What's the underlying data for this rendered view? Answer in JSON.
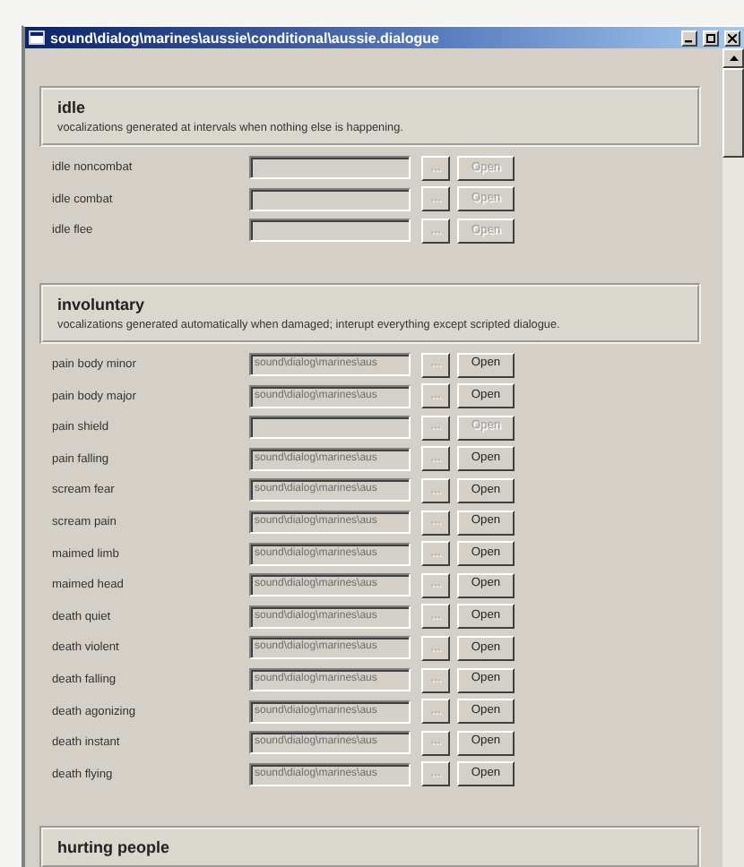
{
  "window": {
    "title": "sound\\dialog\\marines\\aussie\\conditional\\aussie.dialogue"
  },
  "sections": [
    {
      "title": "idle",
      "description": "vocalizations generated at intervals when nothing else is happening.",
      "rows": [
        {
          "label": "idle noncombat",
          "value": "",
          "browse": "...",
          "open": "Open",
          "disabled": true
        },
        {
          "label": "idle combat",
          "value": "",
          "browse": "...",
          "open": "Open",
          "disabled": true
        },
        {
          "label": "idle flee",
          "value": "",
          "browse": "...",
          "open": "Open",
          "disabled": true
        }
      ]
    },
    {
      "title": "involuntary",
      "description": "vocalizations generated automatically when damaged; interupt everything except scripted dialogue.",
      "rows": [
        {
          "label": "pain body minor",
          "value": "sound\\dialog\\marines\\aus",
          "browse": "...",
          "open": "Open",
          "disabled": false
        },
        {
          "label": "pain body major",
          "value": "sound\\dialog\\marines\\aus",
          "browse": "...",
          "open": "Open",
          "disabled": false
        },
        {
          "label": "pain shield",
          "value": "",
          "browse": "...",
          "open": "Open",
          "disabled": true
        },
        {
          "label": "pain falling",
          "value": "sound\\dialog\\marines\\aus",
          "browse": "...",
          "open": "Open",
          "disabled": false
        },
        {
          "label": "scream fear",
          "value": "sound\\dialog\\marines\\aus",
          "browse": "...",
          "open": "Open",
          "disabled": false
        },
        {
          "label": "scream pain",
          "value": "sound\\dialog\\marines\\aus",
          "browse": "...",
          "open": "Open",
          "disabled": false
        },
        {
          "label": "maimed limb",
          "value": "sound\\dialog\\marines\\aus",
          "browse": "...",
          "open": "Open",
          "disabled": false
        },
        {
          "label": "maimed head",
          "value": "sound\\dialog\\marines\\aus",
          "browse": "...",
          "open": "Open",
          "disabled": false
        },
        {
          "label": "death quiet",
          "value": "sound\\dialog\\marines\\aus",
          "browse": "...",
          "open": "Open",
          "disabled": false
        },
        {
          "label": "death violent",
          "value": "sound\\dialog\\marines\\aus",
          "browse": "...",
          "open": "Open",
          "disabled": false
        },
        {
          "label": "death falling",
          "value": "sound\\dialog\\marines\\aus",
          "browse": "...",
          "open": "Open",
          "disabled": false
        },
        {
          "label": "death agonizing",
          "value": "sound\\dialog\\marines\\aus",
          "browse": "...",
          "open": "Open",
          "disabled": false
        },
        {
          "label": "death instant",
          "value": "sound\\dialog\\marines\\aus",
          "browse": "...",
          "open": "Open",
          "disabled": false
        },
        {
          "label": "death flying",
          "value": "sound\\dialog\\marines\\aus",
          "browse": "...",
          "open": "Open",
          "disabled": false
        }
      ]
    },
    {
      "title": "hurting people"
    }
  ]
}
